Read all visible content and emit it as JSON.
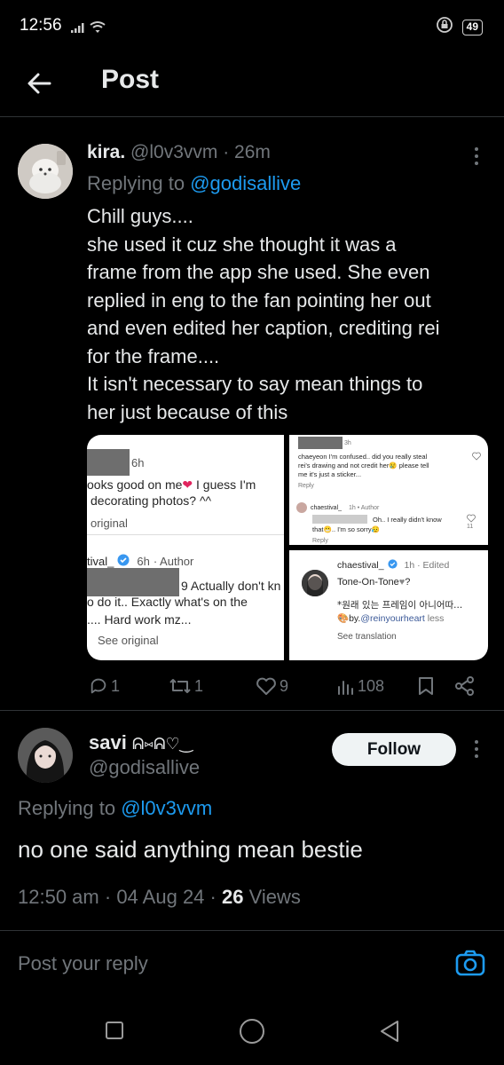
{
  "status": {
    "time": "12:56",
    "battery": "49"
  },
  "header": {
    "title": "Post"
  },
  "parent_tweet": {
    "name": "kira.",
    "handle": "@l0v3vvm",
    "time": "· 26m",
    "replying_prefix": "Replying to ",
    "replying_to": "@godisallive",
    "lines": [
      "Chill guys....",
      "she used it cuz she thought it was a",
      "frame from the app she used. She even",
      "replied in eng to the fan pointing her out",
      "and even edited her caption, crediting rei",
      "for the frame....",
      "It isn't necessary to say mean things to",
      "her just because of this"
    ],
    "actions": {
      "reply": "1",
      "retweet": "1",
      "like": "9",
      "views": "108"
    }
  },
  "media": {
    "left": {
      "time1": "6h",
      "comment1_a": "ooks good on me",
      "comment1_b": " I guess I'm",
      "comment1_c": "decorating photos? ^^",
      "see_original1": "original",
      "author_name": "tival_",
      "author_time": "6h",
      "author_tag": "· Author",
      "reply_a": "9 Actually don't kn",
      "reply_b": "o do it.. Exactly what's on the",
      "reply_c": ".... Hard work mz...",
      "see_original2": "See original"
    },
    "top_right": {
      "time": "3h",
      "comment_a": "chaeyeon I'm confused.. did you really steal",
      "comment_b": "rei's drawing and not credit her",
      "comment_c": " please tell",
      "comment_d": "me it's just a sticker...",
      "reply": "Reply",
      "author_name": "chaestival_",
      "author_meta": "1h • Author",
      "author_a": "Oh.. I really didn't know",
      "author_b": "that",
      "author_c": ".. I'm so sorry",
      "likes": "11",
      "reply2": "Reply"
    },
    "bottom_right": {
      "author_name": "chaestival_",
      "author_meta": "1h · Edited",
      "line1": "Tone-On-Tone",
      "line2": "*원래 있는 프레임이 아니어따...",
      "line3_prefix": "by.",
      "line3_link": "@reinyourheart",
      "line3_suffix": " less",
      "translate": "See translation"
    }
  },
  "reply_tweet": {
    "name": "savi",
    "name_deco": "ᕱ⑅ᕱ♡‿",
    "handle": "@godisallive",
    "follow_label": "Follow",
    "replying_prefix": "Replying to ",
    "replying_to": "@l0v3vvm",
    "text": "no one said anything mean bestie",
    "time": "12:50 am",
    "date": "04 Aug 24",
    "views_count": "26",
    "views_label": " Views"
  },
  "reply_box": {
    "placeholder": "Post your reply"
  },
  "colors": {
    "accent": "#1d9bf0",
    "background": "#000000",
    "muted": "#71767b"
  }
}
